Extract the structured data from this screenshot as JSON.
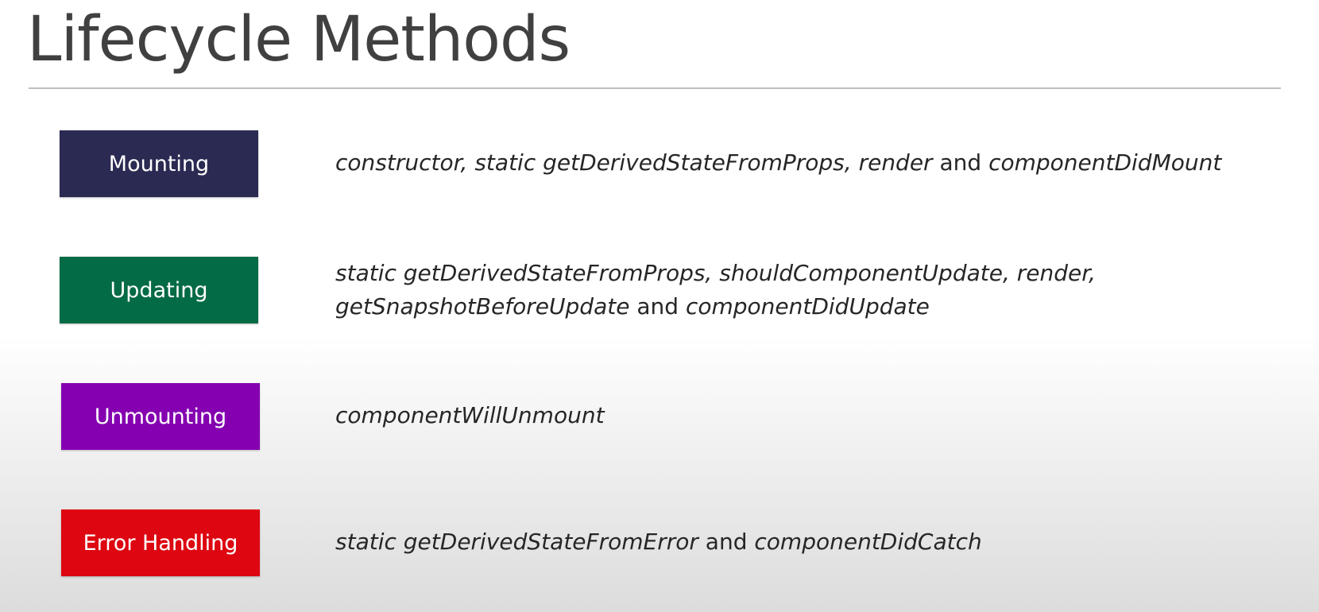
{
  "slide": {
    "title": "Lifecycle Methods"
  },
  "phases": [
    {
      "label": "Mounting",
      "color": "#2a2a52",
      "lines": [
        [
          {
            "text": "constructor, static getDerivedStateFromProps, render",
            "italic": true
          },
          {
            "text": " and ",
            "italic": false
          },
          {
            "text": "componentDidMount",
            "italic": true
          }
        ]
      ]
    },
    {
      "label": "Updating",
      "color": "#036b45",
      "lines": [
        [
          {
            "text": "static getDerivedStateFromProps, shouldComponentUpdate, render,",
            "italic": true
          }
        ],
        [
          {
            "text": "getSnapshotBeforeUpdate",
            "italic": true
          },
          {
            "text": " and ",
            "italic": false
          },
          {
            "text": "componentDidUpdate",
            "italic": true
          }
        ]
      ]
    },
    {
      "label": "Unmounting",
      "color": "#8400b0",
      "lines": [
        [
          {
            "text": "componentWillUnmount",
            "italic": true
          }
        ]
      ]
    },
    {
      "label": "Error Handling",
      "color": "#dd0611",
      "lines": [
        [
          {
            "text": "static getDerivedStateFromError",
            "italic": true
          },
          {
            "text": " and ",
            "italic": false
          },
          {
            "text": "componentDidCatch",
            "italic": true
          }
        ]
      ]
    }
  ]
}
